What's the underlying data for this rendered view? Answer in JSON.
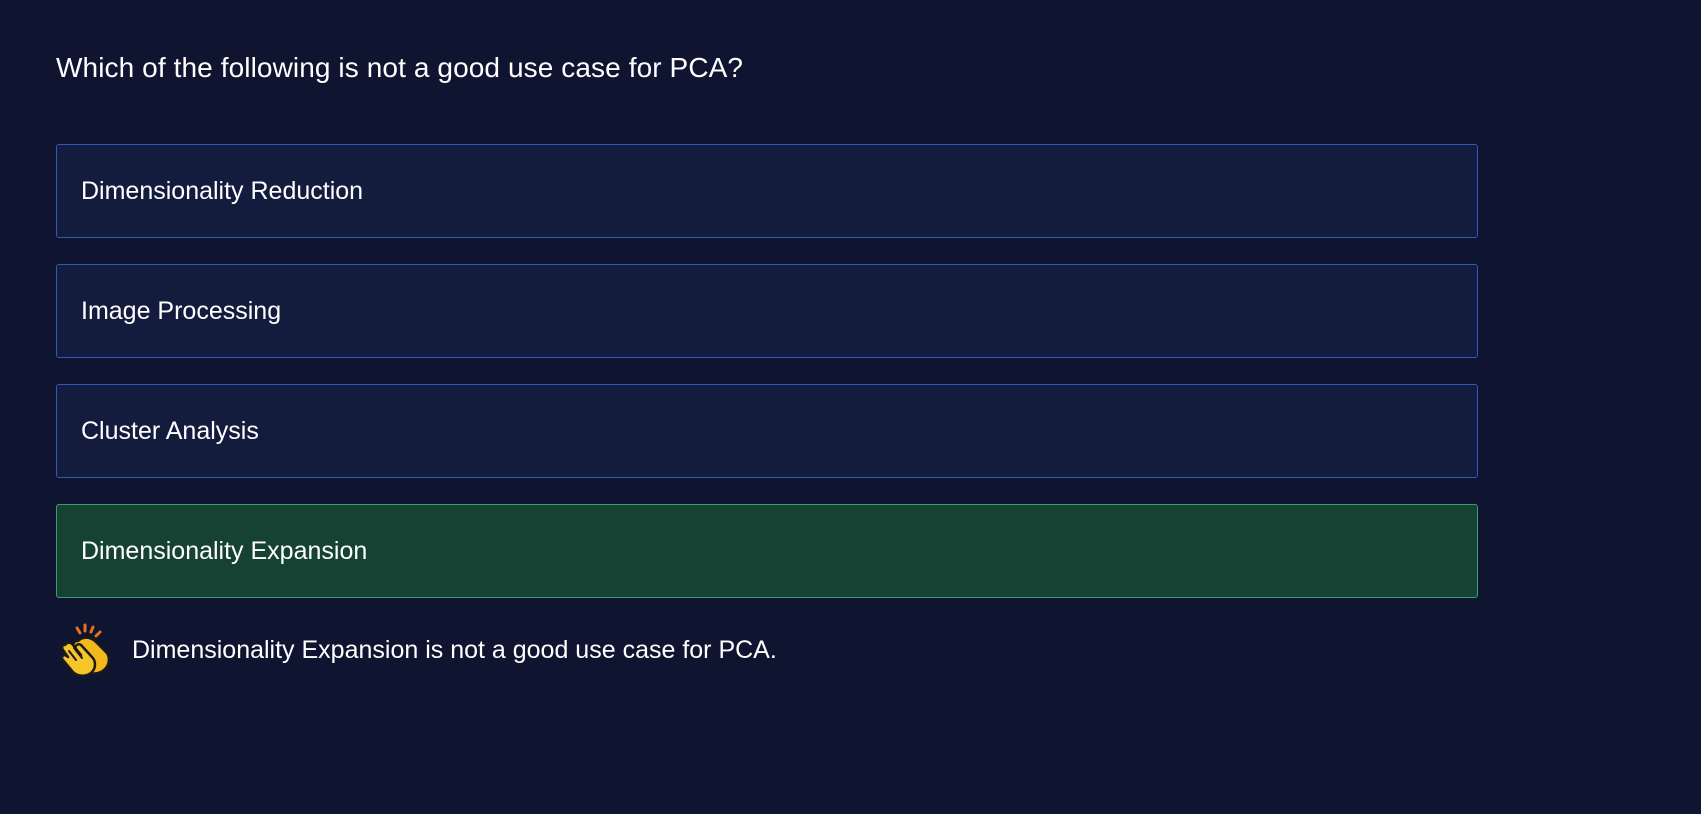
{
  "question": "Which of the following is not a good use case for PCA?",
  "options": [
    {
      "label": "Dimensionality Reduction",
      "state": "default"
    },
    {
      "label": "Image Processing",
      "state": "default"
    },
    {
      "label": "Cluster Analysis",
      "state": "default"
    },
    {
      "label": "Dimensionality Expansion",
      "state": "correct"
    }
  ],
  "feedback": {
    "icon": "clapping-hands-icon",
    "text": "Dimensionality Expansion is not a good use case for PCA."
  },
  "colors": {
    "background": "#0f1430",
    "option_background": "#141c3d",
    "option_border": "#3457b8",
    "correct_background": "#164233",
    "correct_border": "#3e9a72"
  }
}
